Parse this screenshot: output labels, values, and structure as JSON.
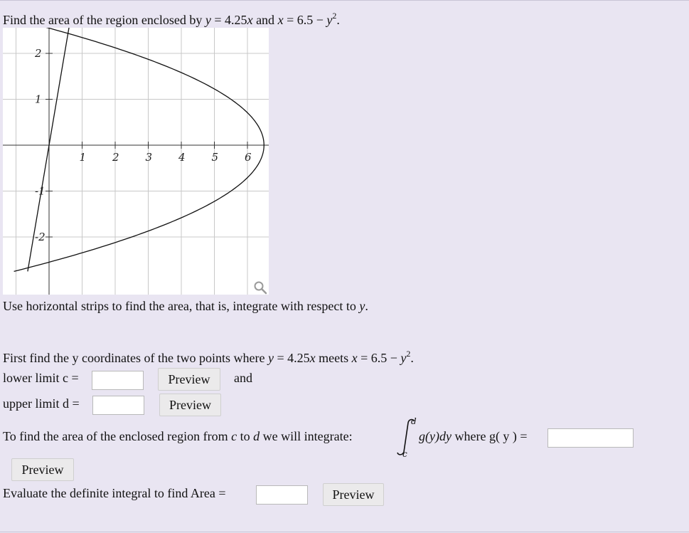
{
  "problem": {
    "prefix": "Find the area of the region enclosed by ",
    "var_y": "y",
    "eq": " = 4.25",
    "var_x": "x",
    "and": " and ",
    "var_x2": "x",
    "eq2": " = 6.5 − ",
    "var_y2": "y",
    "exp": "2",
    "end": "."
  },
  "graph": {
    "x_ticks": [
      "1",
      "2",
      "3",
      "4",
      "5",
      "6"
    ],
    "y_ticks": [
      "2",
      "1",
      "-1",
      "-2"
    ],
    "line_eq": "y = 4.25x",
    "curve_eq": "x = 6.5 - y^2"
  },
  "instruction": {
    "text": "Use horizontal strips to find the area, that is, integrate with respect to ",
    "var": "y",
    "end": "."
  },
  "first_find": {
    "text": "First find the y coordinates of the two points where ",
    "var_y": "y",
    "eq": " = 4.25",
    "var_x": "x",
    "meets": " meets ",
    "var_x2": "x",
    "eq2": " = 6.5 − ",
    "var_y2": "y",
    "exp": "2",
    "end": "."
  },
  "lower_limit": {
    "label": "lower limit c =",
    "value": "",
    "preview": "Preview",
    "and": "and"
  },
  "upper_limit": {
    "label": "upper limit d =",
    "value": "",
    "preview": "Preview"
  },
  "integrate": {
    "text1": "To find the area of the enclosed region from ",
    "c": "c",
    "to": " to ",
    "d": "d",
    "text2": " we will integrate:",
    "upper": "d",
    "lower": "c",
    "integrand_g": "g",
    "integrand_y": "(y)dy",
    "where": " where g( y ) =",
    "value": "",
    "preview": "Preview"
  },
  "evaluate": {
    "label": "Evaluate the definite integral to find Area =",
    "value": "",
    "preview": "Preview"
  }
}
